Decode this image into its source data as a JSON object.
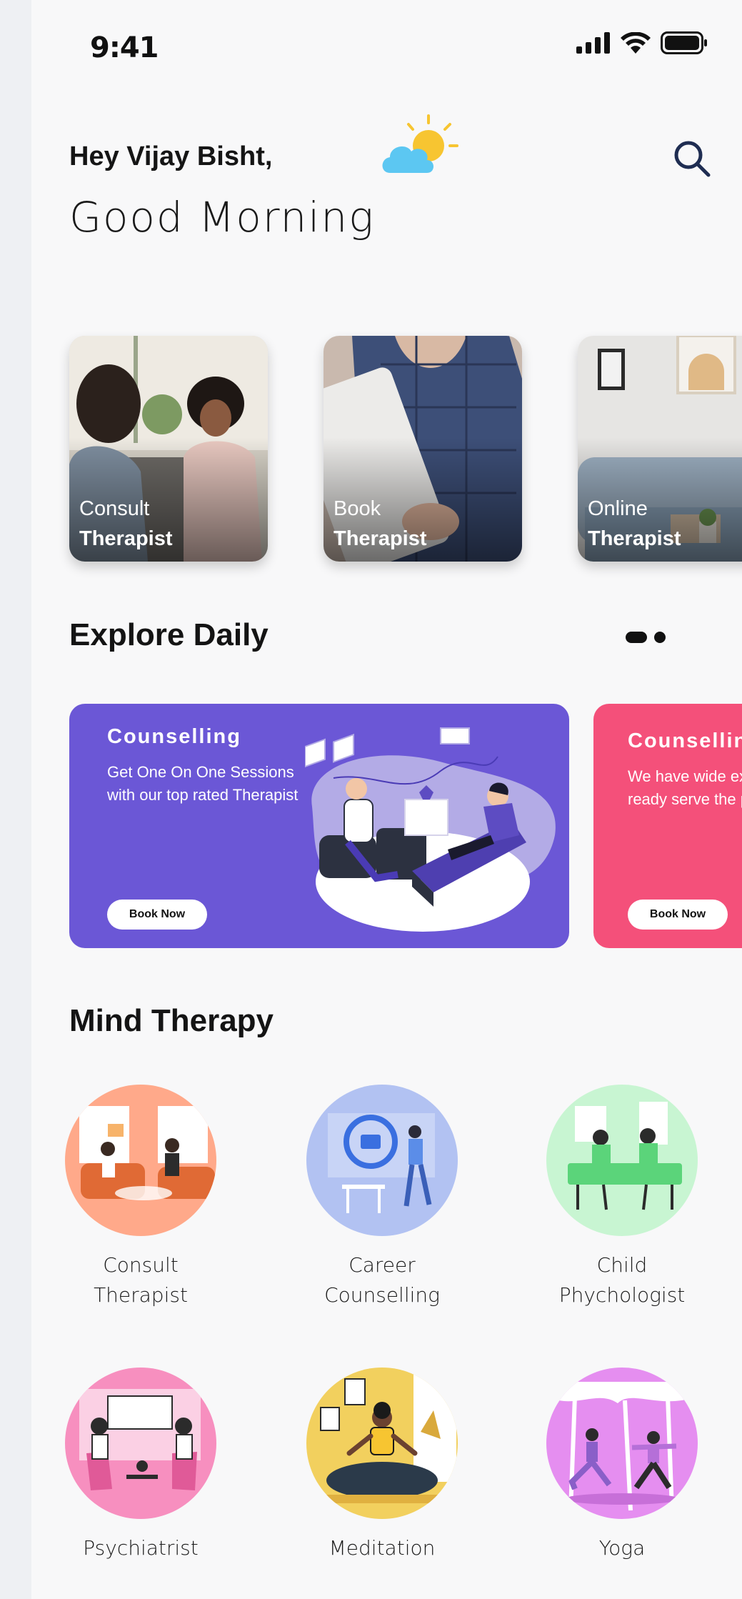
{
  "status_bar": {
    "time": "9:41"
  },
  "header": {
    "greeting_name": "Hey Vijay Bisht,",
    "greeting_time": "Good Morning",
    "weather_icon": "sun-cloud-icon",
    "search_icon": "search-icon"
  },
  "hero_cards": [
    {
      "line1": "Consult",
      "line2": "Therapist"
    },
    {
      "line1": "Book",
      "line2": "Therapist"
    },
    {
      "line1": "Online",
      "line2": "Therapist"
    }
  ],
  "explore": {
    "title": "Explore Daily",
    "cards": [
      {
        "title": "Counselling",
        "description": "Get One On One Sessions with our top rated Therapist",
        "button": "Book Now",
        "color": "#6b57d6"
      },
      {
        "title": "Counselling",
        "description": "We have wide experts ready serve the purp",
        "button": "Book Now",
        "color": "#f4507a"
      }
    ]
  },
  "mind_therapy": {
    "title": "Mind Therapy",
    "items": [
      {
        "label": "Consult\nTherapist",
        "color": "#ffa98a"
      },
      {
        "label": "Career\nCounselling",
        "color": "#b2c2f2"
      },
      {
        "label": "Child\nPhychologist",
        "color": "#c8f5d2"
      },
      {
        "label": "Psychiatrist",
        "color": "#f78fbf"
      },
      {
        "label": "Meditation",
        "color": "#f2d05e"
      },
      {
        "label": "Yoga",
        "color": "#e58ef0"
      }
    ]
  }
}
